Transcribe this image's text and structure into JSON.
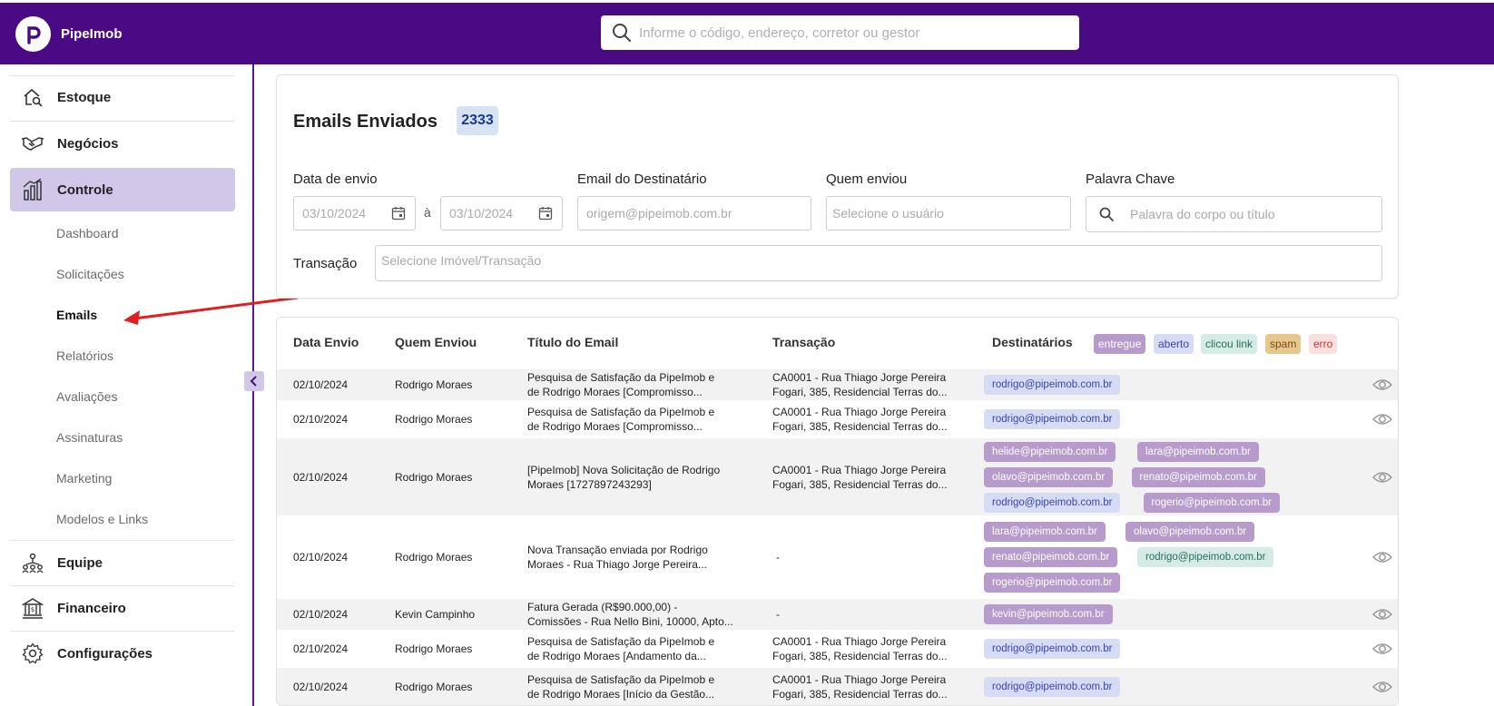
{
  "app": {
    "brand": "PipeImob"
  },
  "search": {
    "placeholder": "Informe o código, endereço, corretor ou gestor"
  },
  "sidebar": {
    "items": [
      {
        "label": "Estoque",
        "icon": "house-search-icon"
      },
      {
        "label": "Negócios",
        "icon": "handshake-icon"
      },
      {
        "label": "Controle",
        "icon": "chart-bars-icon"
      },
      {
        "label": "Equipe",
        "icon": "team-icon"
      },
      {
        "label": "Financeiro",
        "icon": "bank-icon"
      },
      {
        "label": "Configurações",
        "icon": "gear-icon"
      }
    ],
    "subitems": [
      "Dashboard",
      "Solicitações",
      "Emails",
      "Relatórios",
      "Avaliações",
      "Assinaturas",
      "Marketing",
      "Modelos e Links"
    ]
  },
  "filters": {
    "title": "Emails Enviados",
    "count": "2333",
    "date_label": "Data de envio",
    "date_from": "03/10/2024",
    "date_sep": "à",
    "date_to": "03/10/2024",
    "recipient_label": "Email do Destinatário",
    "recipient_placeholder": "origem@pipeimob.com.br",
    "sender_label": "Quem enviou",
    "sender_placeholder": "Selecione o usuário",
    "keyword_label": "Palavra Chave",
    "keyword_placeholder": "Palavra do corpo ou título",
    "transaction_label": "Transação",
    "transaction_placeholder": "Selecione Imóvel/Transação"
  },
  "table": {
    "headers": [
      "Data Envio",
      "Quem Enviou",
      "Título do Email",
      "Transação",
      "Destinatários"
    ],
    "legend": [
      "entregue",
      "aberto",
      "clicou link",
      "spam",
      "erro"
    ],
    "colors": {
      "entregue": "#b89bcd",
      "aberto": "#d7dcf5",
      "clicou": "#d4ebe6",
      "spam": "#e6c78e",
      "erro": "#fbe0e0"
    },
    "rows": [
      {
        "date": "02/10/2024",
        "sender": "Rodrigo Moraes",
        "title1": "Pesquisa de Satisfação da PipeImob e",
        "title2": "de Rodrigo Moraes [Compromisso...",
        "tx1": "CA0001 - Rua Thiago Jorge Pereira",
        "tx2": "Fogari, 385, Residencial Terras do...",
        "recipients": [
          {
            "email": "rodrigo@pipeimob.com.br",
            "status": "aberto"
          }
        ]
      },
      {
        "date": "02/10/2024",
        "sender": "Rodrigo Moraes",
        "title1": "Pesquisa de Satisfação da PipeImob e",
        "title2": "de Rodrigo Moraes [Compromisso...",
        "tx1": "CA0001 - Rua Thiago Jorge Pereira",
        "tx2": "Fogari, 385, Residencial Terras do...",
        "recipients": [
          {
            "email": "rodrigo@pipeimob.com.br",
            "status": "aberto"
          }
        ]
      },
      {
        "date": "02/10/2024",
        "sender": "Rodrigo Moraes",
        "title1": "[PipeImob] Nova Solicitação de Rodrigo",
        "title2": "Moraes [1727897243293]",
        "tx1": "CA0001 - Rua Thiago Jorge Pereira",
        "tx2": "Fogari, 385, Residencial Terras do...",
        "recipients": [
          {
            "email": "helide@pipeimob.com.br",
            "status": "entregue"
          },
          {
            "email": "lara@pipeimob.com.br",
            "status": "entregue"
          },
          {
            "email": "olavo@pipeimob.com.br",
            "status": "entregue"
          },
          {
            "email": "renato@pipeimob.com.br",
            "status": "entregue"
          },
          {
            "email": "rodrigo@pipeimob.com.br",
            "status": "aberto"
          },
          {
            "email": "rogerio@pipeimob.com.br",
            "status": "entregue"
          }
        ]
      },
      {
        "date": "02/10/2024",
        "sender": "Rodrigo Moraes",
        "title1": "Nova Transação enviada por Rodrigo",
        "title2": "Moraes - Rua Thiago Jorge Pereira...",
        "tx1": "-",
        "tx2": "",
        "recipients": [
          {
            "email": "lara@pipeimob.com.br",
            "status": "entregue"
          },
          {
            "email": "olavo@pipeimob.com.br",
            "status": "entregue"
          },
          {
            "email": "renato@pipeimob.com.br",
            "status": "entregue"
          },
          {
            "email": "rodrigo@pipeimob.com.br",
            "status": "clicou"
          },
          {
            "email": "rogerio@pipeimob.com.br",
            "status": "entregue"
          }
        ]
      },
      {
        "date": "02/10/2024",
        "sender": "Kevin Campinho",
        "title1": "Fatura Gerada (R$90.000,00) -",
        "title2": "Comissões - Rua Nello Bini, 10000, Apto...",
        "tx1": "-",
        "tx2": "",
        "recipients": [
          {
            "email": "kevin@pipeimob.com.br",
            "status": "entregue"
          }
        ]
      },
      {
        "date": "02/10/2024",
        "sender": "Rodrigo Moraes",
        "title1": "Pesquisa de Satisfação da PipeImob e",
        "title2": "de Rodrigo Moraes [Andamento da...",
        "tx1": "CA0001 - Rua Thiago Jorge Pereira",
        "tx2": "Fogari, 385, Residencial Terras do...",
        "recipients": [
          {
            "email": "rodrigo@pipeimob.com.br",
            "status": "aberto"
          }
        ]
      },
      {
        "date": "02/10/2024",
        "sender": "Rodrigo Moraes",
        "title1": "Pesquisa de Satisfação da PipeImob e",
        "title2": "de Rodrigo Moraes [Início da Gestão...",
        "tx1": "CA0001 - Rua Thiago Jorge Pereira",
        "tx2": "Fogari, 385, Residencial Terras do...",
        "recipients": [
          {
            "email": "rodrigo@pipeimob.com.br",
            "status": "aberto"
          }
        ]
      }
    ]
  }
}
